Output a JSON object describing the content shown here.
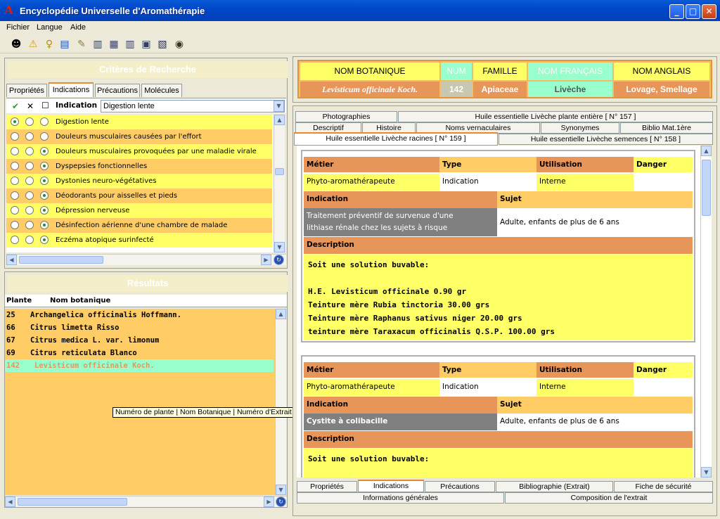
{
  "window": {
    "title": "Encyclopédie Universelle d'Aromathérapie",
    "app_glyph": "A"
  },
  "menu": {
    "items": [
      "Fichier",
      "Langue",
      "Aide"
    ]
  },
  "toolbar": {
    "icons": [
      "person-icon",
      "warning-icon",
      "pin-icon",
      "book-icon",
      "note-icon",
      "layout1-icon",
      "layout2-icon",
      "layout3-icon",
      "export-icon",
      "screen-icon",
      "globe-icon"
    ]
  },
  "criteria": {
    "title": "Critères de Recherche",
    "tabs": [
      "Propriétés",
      "Indications",
      "Précautions",
      "Molécules"
    ],
    "active_tab": "Indications",
    "header_check": "✔",
    "header_x": "✕",
    "header_box": "☐",
    "column_label": "Indication",
    "combo_value": "Digestion lente",
    "rows": [
      {
        "text": "Digestion lente",
        "sel": 0
      },
      {
        "text": "Douleurs musculaires causées par l'effort",
        "sel": -1
      },
      {
        "text": "Douleurs musculaires provoquées par une maladie virale",
        "sel": 2
      },
      {
        "text": "Dyspepsies fonctionnelles",
        "sel": 2
      },
      {
        "text": "Dystonies neuro-végétatives",
        "sel": 2
      },
      {
        "text": "Déodorants pour aisselles et pieds",
        "sel": 2
      },
      {
        "text": "Dépression nerveuse",
        "sel": 2
      },
      {
        "text": "Désinfection aérienne d'une chambre de malade",
        "sel": 2
      },
      {
        "text": "Eczéma atopique surinfecté",
        "sel": 2
      }
    ]
  },
  "results": {
    "title": "Résultats",
    "col_plante": "Plante",
    "col_nom": "Nom botanique",
    "rows": [
      {
        "num": "25",
        "name": "Archangelica officinalis  Hoffmann."
      },
      {
        "num": "66",
        "name": "Citrus limetta Risso"
      },
      {
        "num": "67",
        "name": "Citrus medica L. var. limonum"
      },
      {
        "num": "69",
        "name": "Citrus reticulata Blanco"
      },
      {
        "num": "142",
        "name": "Levisticum officinale Koch."
      }
    ],
    "selected_index": 4
  },
  "tooltip": "Numéro de plante | Nom Botanique | Numéro d'Extrait | Type d'Extrait",
  "plant": {
    "headers": [
      "NOM BOTANIQUE",
      "NUM",
      "FAMILLE",
      "NOM FRANÇAIS",
      "NOM ANGLAIS"
    ],
    "values": [
      "Levisticum officinale Koch.",
      "142",
      "Apiaceae",
      "Livèche",
      "Lovage, Smellage"
    ]
  },
  "detail_tabs": {
    "row1": [
      "Photographies",
      "Huile essentielle Livèche plante entière [ N° 157 ]"
    ],
    "row2": [
      "Descriptif",
      "Histoire",
      "Noms vernaculaires",
      "Synonymes",
      "Biblio Mat.1ère"
    ],
    "row3": [
      "Huile essentielle Livèche racines [ N° 159 ]",
      "Huile essentielle Livèche semences [ N° 158 ]"
    ]
  },
  "cards": [
    {
      "h_metier": "Métier",
      "h_type": "Type",
      "h_util": "Utilisation",
      "h_danger": "Danger",
      "metier": "Phyto-aromathérapeute",
      "type": "Indication",
      "util": "Interne",
      "danger": "",
      "h_indication": "Indication",
      "h_sujet": "Sujet",
      "indication": "Traitement préventif de survenue d'une lithiase rénale chez les sujets à risque",
      "indication_l1": "Traitement préventif de survenue d'une",
      "indication_l2": "lithiase rénale chez les sujets à risque",
      "sujet": "Adulte, enfants de plus de 6 ans",
      "h_description": "Description",
      "description": [
        "Soit une solution buvable:",
        "",
        "H.E. Levisticum officinale 0.90 gr",
        "Teinture mère Rubia tinctoria 30.00 grs",
        "Teinture mère Raphanus sativus niger 20.00 grs",
        "teinture mère Taraxacum officinalis Q.S.P. 100.00 grs"
      ]
    },
    {
      "h_metier": "Métier",
      "h_type": "Type",
      "h_util": "Utilisation",
      "h_danger": "Danger",
      "metier": "Phyto-aromathérapeute",
      "type": "Indication",
      "util": "Interne",
      "danger": "",
      "h_indication": "Indication",
      "h_sujet": "Sujet",
      "indication": "Cystite à colibacille",
      "sujet": "Adulte, enfants de plus de 6 ans",
      "h_description": "Description",
      "description": [
        "Soit une solution buvable:"
      ]
    }
  ],
  "bottom_tabs": {
    "row1": [
      "Propriétés",
      "Indications",
      "Précautions",
      "Bibliographie (Extrait)",
      "Fiche de sécurité"
    ],
    "row2": [
      "Informations générales",
      "Composition de l'extrait"
    ],
    "active": "Indications"
  },
  "colors": {
    "yellow": "#ffff66",
    "orange": "#e8955a",
    "light_orange": "#ffcc66",
    "gray": "#808080",
    "mint": "#99ffcc",
    "row_alt": "#ffcc66"
  }
}
